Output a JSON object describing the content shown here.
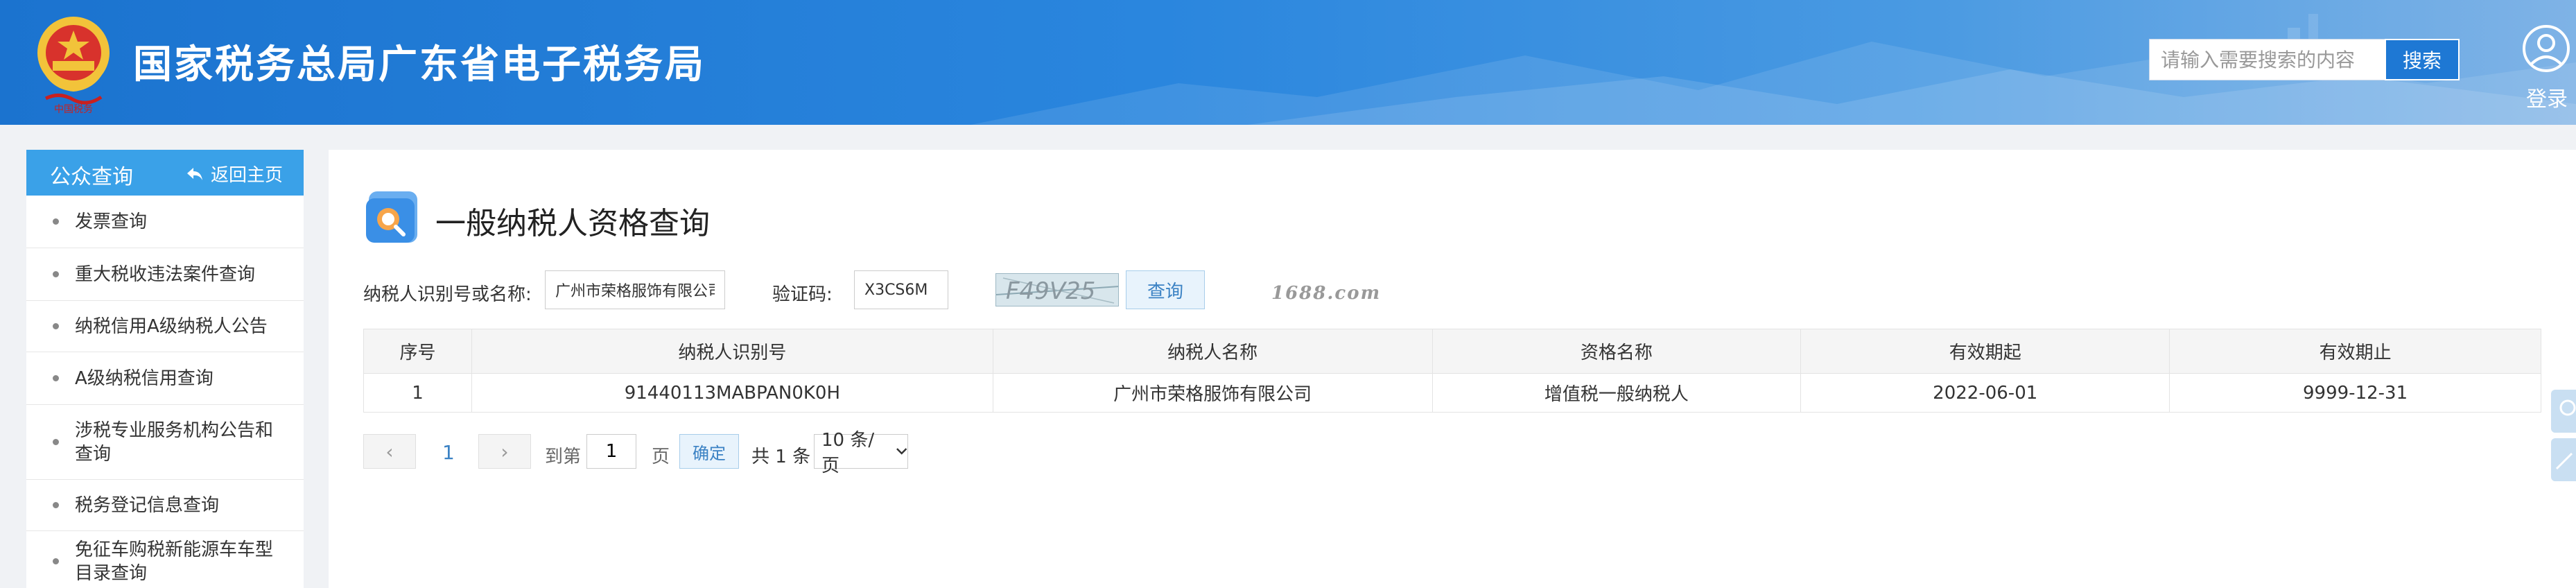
{
  "header": {
    "site_title": "国家税务总局广东省电子税务局",
    "search_placeholder": "请输入需要搜索的内容",
    "search_button": "搜索",
    "login_label": "登录"
  },
  "sidebar": {
    "title": "公众查询",
    "back_label": "返回主页",
    "items": [
      {
        "label": "发票查询"
      },
      {
        "label": "重大税收违法案件查询"
      },
      {
        "label": "纳税信用A级纳税人公告"
      },
      {
        "label": "A级纳税信用查询"
      },
      {
        "label": "涉税专业服务机构公告和查询"
      },
      {
        "label": "税务登记信息查询"
      },
      {
        "label": "免征车购税新能源车车型目录查询"
      }
    ]
  },
  "main": {
    "page_title": "一般纳税人资格查询",
    "form": {
      "taxpayer_label": "纳税人识别号或名称:",
      "taxpayer_value": "广州市荣格服饰有限公司",
      "captcha_label": "验证码:",
      "captcha_value": "X3CS6M",
      "captcha_image_text": "F49V25",
      "query_button": "查询",
      "watermark": "1688.com"
    },
    "table": {
      "headers": [
        "序号",
        "纳税人识别号",
        "纳税人名称",
        "资格名称",
        "有效期起",
        "有效期止"
      ],
      "rows": [
        [
          "1",
          "91440113MABPAN0K0H",
          "广州市荣格服饰有限公司",
          "增值税一般纳税人",
          "2022-06-01",
          "9999-12-31"
        ]
      ]
    },
    "pager": {
      "current_page": "1",
      "goto_label": "到第",
      "goto_value": "1",
      "page_unit": "页",
      "confirm_label": "确定",
      "total_label": "共 1 条",
      "page_size": "10 条/页"
    }
  },
  "colors": {
    "header_blue": "#1b73cf",
    "sidebar_head": "#3aa1e8",
    "link_blue": "#3b82c4"
  }
}
